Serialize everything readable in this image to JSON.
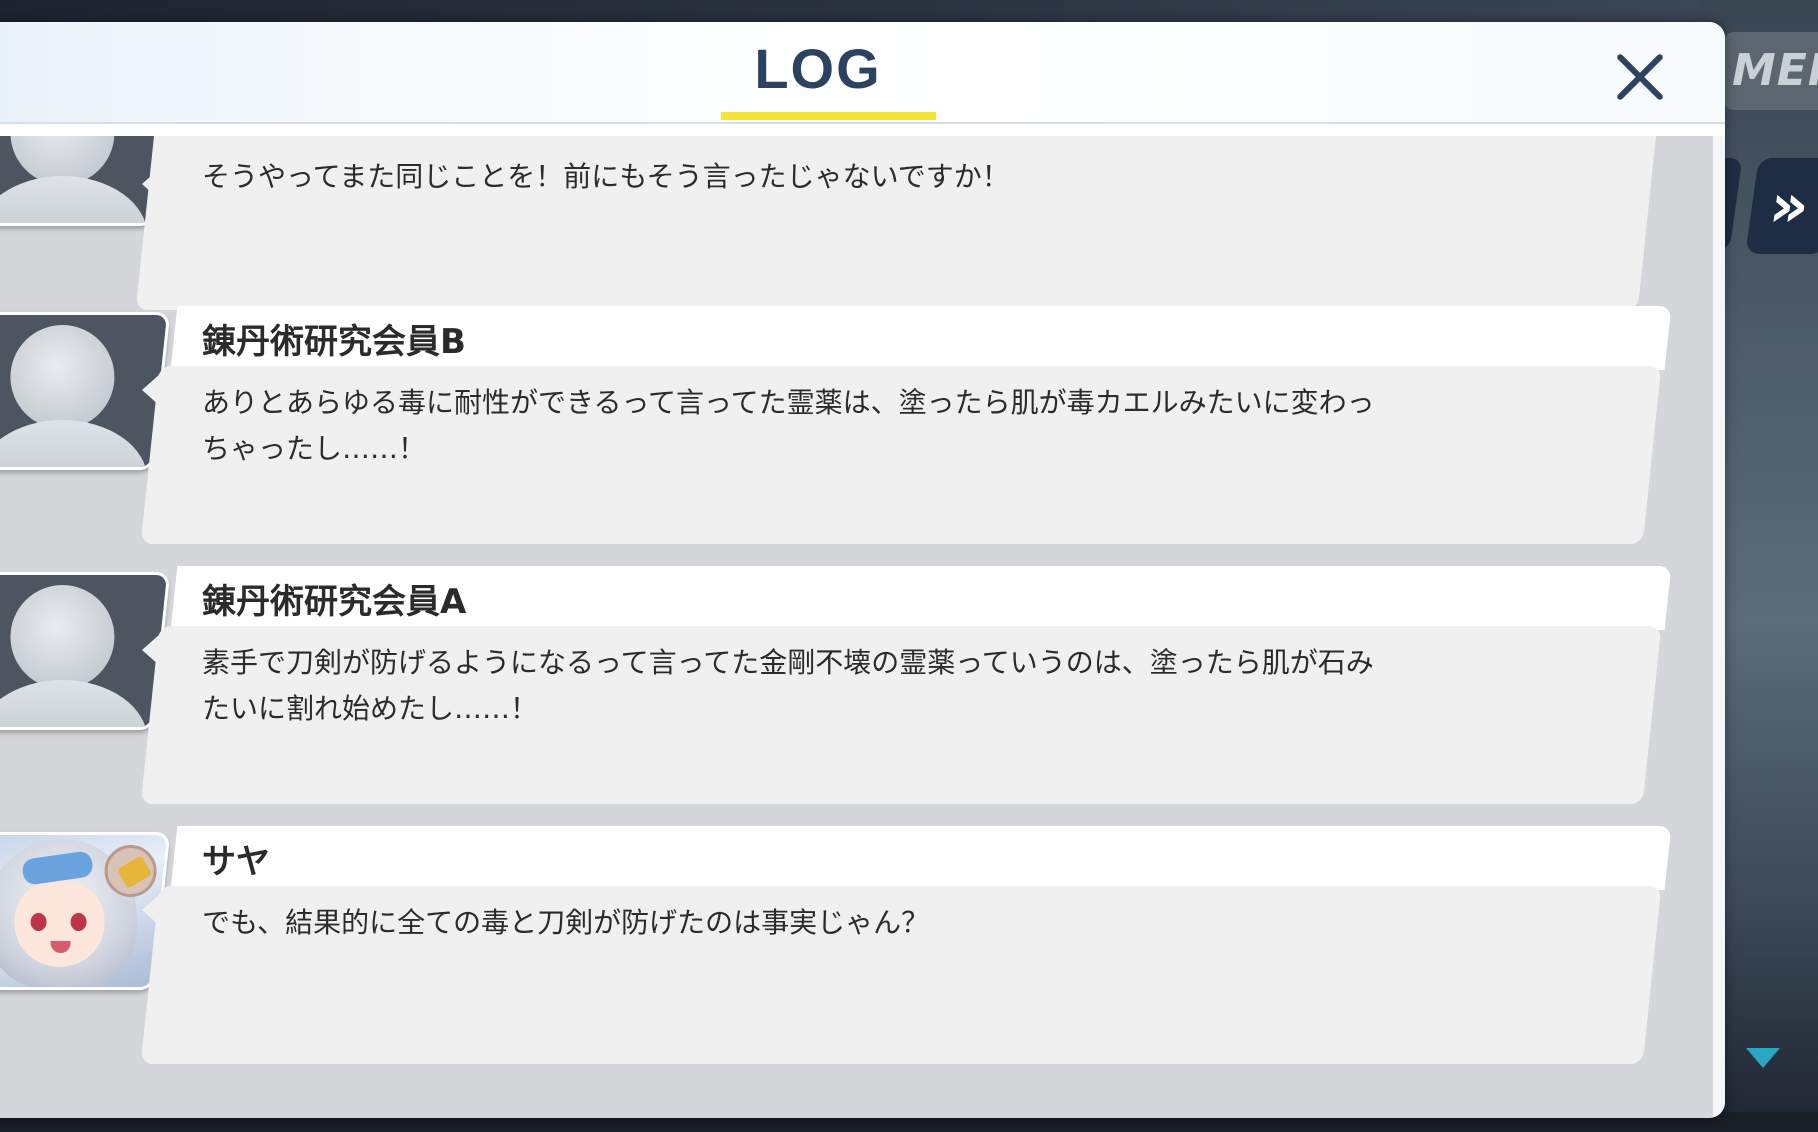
{
  "header": {
    "title": "LOG",
    "close_label": "×"
  },
  "hud": {
    "menu_label": "MEN",
    "skip_label": "»"
  },
  "entries": [
    {
      "speaker": "",
      "avatar": "silhouette",
      "text": "そうやってまた同じことを！前にもそう言ったじゃないですか！"
    },
    {
      "speaker": "錬丹術研究会員B",
      "avatar": "silhouette",
      "text": "ありとあらゆる毒に耐性ができるって言ってた霊薬は、塗ったら肌が毒カエルみたいに変わっ\nちゃったし……！"
    },
    {
      "speaker": "錬丹術研究会員A",
      "avatar": "silhouette",
      "text": "素手で刀剣が防げるようになるって言ってた金剛不壊の霊薬っていうのは、塗ったら肌が石み\nたいに割れ始めたし……！"
    },
    {
      "speaker": "サヤ",
      "avatar": "saya-portrait",
      "text": "でも、結果的に全ての毒と刀剣が防げたのは事実じゃん？"
    }
  ]
}
